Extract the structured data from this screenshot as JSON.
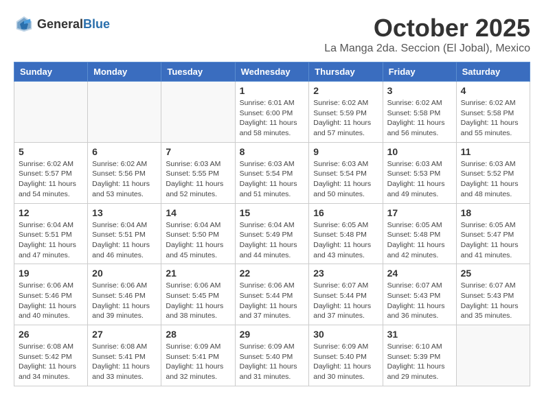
{
  "header": {
    "logo_general": "General",
    "logo_blue": "Blue",
    "title": "October 2025",
    "subtitle": "La Manga 2da. Seccion (El Jobal), Mexico"
  },
  "weekdays": [
    "Sunday",
    "Monday",
    "Tuesday",
    "Wednesday",
    "Thursday",
    "Friday",
    "Saturday"
  ],
  "weeks": [
    [
      {
        "day": "",
        "info": ""
      },
      {
        "day": "",
        "info": ""
      },
      {
        "day": "",
        "info": ""
      },
      {
        "day": "1",
        "info": "Sunrise: 6:01 AM\nSunset: 6:00 PM\nDaylight: 11 hours\nand 58 minutes."
      },
      {
        "day": "2",
        "info": "Sunrise: 6:02 AM\nSunset: 5:59 PM\nDaylight: 11 hours\nand 57 minutes."
      },
      {
        "day": "3",
        "info": "Sunrise: 6:02 AM\nSunset: 5:58 PM\nDaylight: 11 hours\nand 56 minutes."
      },
      {
        "day": "4",
        "info": "Sunrise: 6:02 AM\nSunset: 5:58 PM\nDaylight: 11 hours\nand 55 minutes."
      }
    ],
    [
      {
        "day": "5",
        "info": "Sunrise: 6:02 AM\nSunset: 5:57 PM\nDaylight: 11 hours\nand 54 minutes."
      },
      {
        "day": "6",
        "info": "Sunrise: 6:02 AM\nSunset: 5:56 PM\nDaylight: 11 hours\nand 53 minutes."
      },
      {
        "day": "7",
        "info": "Sunrise: 6:03 AM\nSunset: 5:55 PM\nDaylight: 11 hours\nand 52 minutes."
      },
      {
        "day": "8",
        "info": "Sunrise: 6:03 AM\nSunset: 5:54 PM\nDaylight: 11 hours\nand 51 minutes."
      },
      {
        "day": "9",
        "info": "Sunrise: 6:03 AM\nSunset: 5:54 PM\nDaylight: 11 hours\nand 50 minutes."
      },
      {
        "day": "10",
        "info": "Sunrise: 6:03 AM\nSunset: 5:53 PM\nDaylight: 11 hours\nand 49 minutes."
      },
      {
        "day": "11",
        "info": "Sunrise: 6:03 AM\nSunset: 5:52 PM\nDaylight: 11 hours\nand 48 minutes."
      }
    ],
    [
      {
        "day": "12",
        "info": "Sunrise: 6:04 AM\nSunset: 5:51 PM\nDaylight: 11 hours\nand 47 minutes."
      },
      {
        "day": "13",
        "info": "Sunrise: 6:04 AM\nSunset: 5:51 PM\nDaylight: 11 hours\nand 46 minutes."
      },
      {
        "day": "14",
        "info": "Sunrise: 6:04 AM\nSunset: 5:50 PM\nDaylight: 11 hours\nand 45 minutes."
      },
      {
        "day": "15",
        "info": "Sunrise: 6:04 AM\nSunset: 5:49 PM\nDaylight: 11 hours\nand 44 minutes."
      },
      {
        "day": "16",
        "info": "Sunrise: 6:05 AM\nSunset: 5:48 PM\nDaylight: 11 hours\nand 43 minutes."
      },
      {
        "day": "17",
        "info": "Sunrise: 6:05 AM\nSunset: 5:48 PM\nDaylight: 11 hours\nand 42 minutes."
      },
      {
        "day": "18",
        "info": "Sunrise: 6:05 AM\nSunset: 5:47 PM\nDaylight: 11 hours\nand 41 minutes."
      }
    ],
    [
      {
        "day": "19",
        "info": "Sunrise: 6:06 AM\nSunset: 5:46 PM\nDaylight: 11 hours\nand 40 minutes."
      },
      {
        "day": "20",
        "info": "Sunrise: 6:06 AM\nSunset: 5:46 PM\nDaylight: 11 hours\nand 39 minutes."
      },
      {
        "day": "21",
        "info": "Sunrise: 6:06 AM\nSunset: 5:45 PM\nDaylight: 11 hours\nand 38 minutes."
      },
      {
        "day": "22",
        "info": "Sunrise: 6:06 AM\nSunset: 5:44 PM\nDaylight: 11 hours\nand 37 minutes."
      },
      {
        "day": "23",
        "info": "Sunrise: 6:07 AM\nSunset: 5:44 PM\nDaylight: 11 hours\nand 37 minutes."
      },
      {
        "day": "24",
        "info": "Sunrise: 6:07 AM\nSunset: 5:43 PM\nDaylight: 11 hours\nand 36 minutes."
      },
      {
        "day": "25",
        "info": "Sunrise: 6:07 AM\nSunset: 5:43 PM\nDaylight: 11 hours\nand 35 minutes."
      }
    ],
    [
      {
        "day": "26",
        "info": "Sunrise: 6:08 AM\nSunset: 5:42 PM\nDaylight: 11 hours\nand 34 minutes."
      },
      {
        "day": "27",
        "info": "Sunrise: 6:08 AM\nSunset: 5:41 PM\nDaylight: 11 hours\nand 33 minutes."
      },
      {
        "day": "28",
        "info": "Sunrise: 6:09 AM\nSunset: 5:41 PM\nDaylight: 11 hours\nand 32 minutes."
      },
      {
        "day": "29",
        "info": "Sunrise: 6:09 AM\nSunset: 5:40 PM\nDaylight: 11 hours\nand 31 minutes."
      },
      {
        "day": "30",
        "info": "Sunrise: 6:09 AM\nSunset: 5:40 PM\nDaylight: 11 hours\nand 30 minutes."
      },
      {
        "day": "31",
        "info": "Sunrise: 6:10 AM\nSunset: 5:39 PM\nDaylight: 11 hours\nand 29 minutes."
      },
      {
        "day": "",
        "info": ""
      }
    ]
  ]
}
